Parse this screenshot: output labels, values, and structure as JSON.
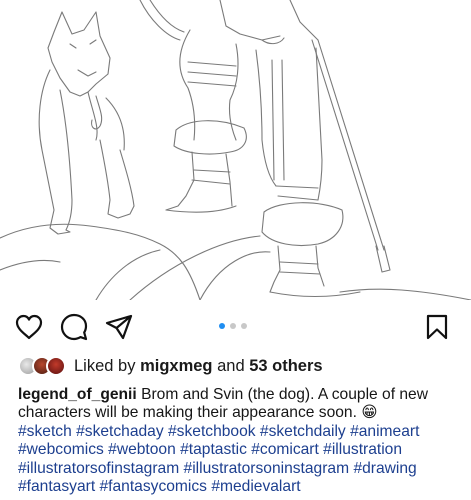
{
  "post": {
    "image_alt": "Line sketch of Brom and Svin"
  },
  "actions": {
    "like": "heart-icon",
    "comment": "comment-icon",
    "share": "paper-plane-icon",
    "save": "bookmark-icon"
  },
  "carousel": {
    "count": 3,
    "active": 0
  },
  "likes": {
    "prefix": "Liked by",
    "user": "migxmeg",
    "middle": "and",
    "others": "53 others"
  },
  "caption": {
    "username": "legend_of_genii",
    "text_line1": "Brom and Svin (the dog). A couple of new",
    "text_line2": "characters will be making their appearance soon. 😁",
    "hashtags_line1": [
      "#sketch",
      "#sketchaday",
      "#sketchbook",
      "#sketchdaily",
      "#animeart"
    ],
    "hashtags_line2": [
      "#webcomics",
      "#webtoon",
      "#taptastic",
      "#comicart",
      "#illustration"
    ],
    "hashtags_line3": [
      "#illustratorsofinstagram",
      "#illustratorsoninstagram",
      "#drawing"
    ],
    "hashtags_line4": [
      "#fantasyart",
      "#fantasycomics",
      "#medievalart"
    ]
  },
  "colors": {
    "hashtag": "#1d3f8f",
    "active_dot": "#1f8ef1",
    "inactive_dot": "#c8c8c8"
  }
}
